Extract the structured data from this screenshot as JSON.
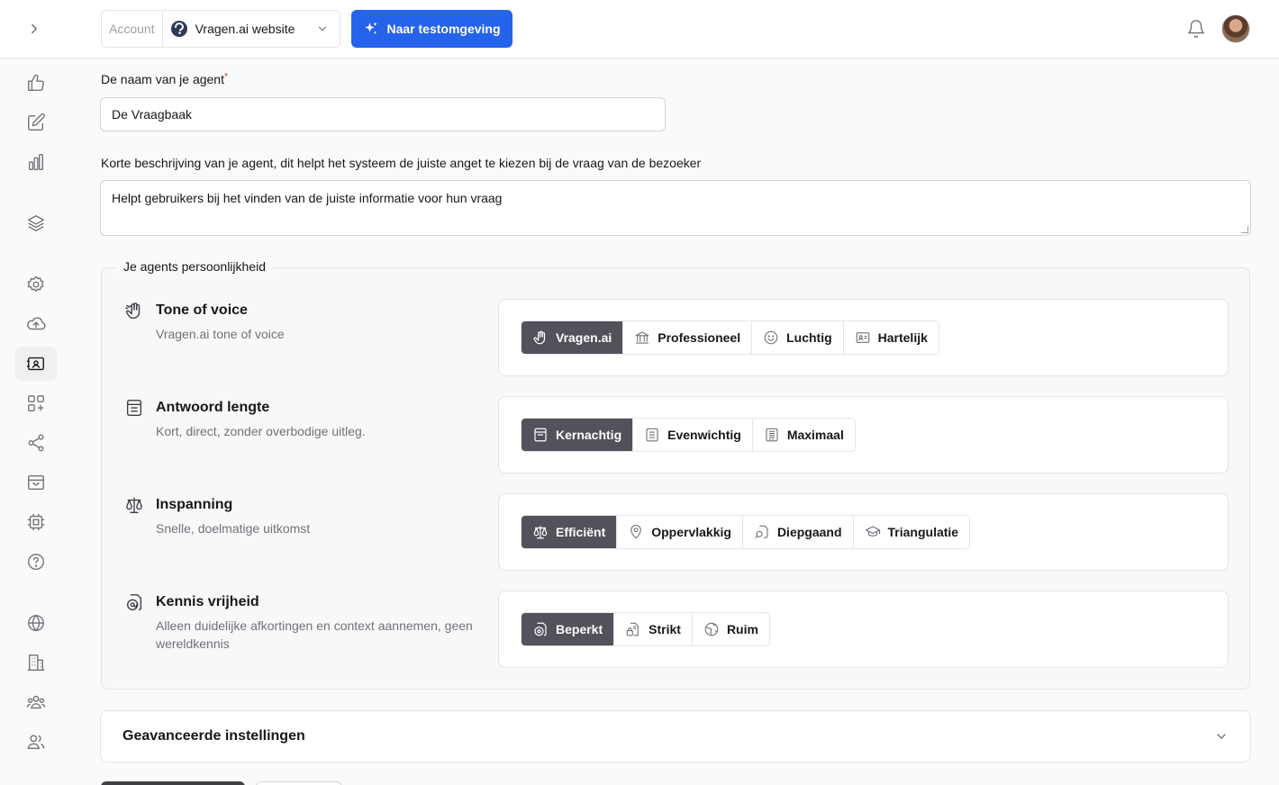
{
  "header": {
    "account_label": "Account",
    "account_name": "Vragen.ai website",
    "test_button_label": "Naar testomgeving"
  },
  "sidebar": {
    "items": [
      {
        "icon": "thumbs-up-icon"
      },
      {
        "icon": "edit-icon"
      },
      {
        "icon": "bar-chart-icon"
      },
      {
        "icon": "layers-icon"
      },
      {
        "icon": "gear-icon"
      },
      {
        "icon": "cloud-upload-icon"
      },
      {
        "icon": "agent-card-icon",
        "active": true
      },
      {
        "icon": "apps-add-icon"
      },
      {
        "icon": "share-icon"
      },
      {
        "icon": "inbox-icon"
      },
      {
        "icon": "chip-icon"
      },
      {
        "icon": "help-icon"
      },
      {
        "icon": "globe-icon"
      },
      {
        "icon": "building-icon"
      },
      {
        "icon": "team-icon"
      },
      {
        "icon": "users-icon"
      }
    ]
  },
  "form": {
    "name_label": "De naam van je agent",
    "name_required_mark": "*",
    "name_value": "De Vraagbaak",
    "description_label": "Korte beschrijving van je agent, dit helpt het systeem de juiste anget te kiezen bij de vraag van de bezoeker",
    "description_value": "Helpt gebruikers bij het vinden van de juiste informatie voor hun vraag"
  },
  "personality": {
    "legend": "Je agents persoonlijkheid",
    "tone": {
      "title": "Tone of voice",
      "description": "Vragen.ai tone of voice",
      "options": [
        "Vragen.ai",
        "Professioneel",
        "Luchtig",
        "Hartelijk"
      ],
      "selected": "Vragen.ai"
    },
    "length": {
      "title": "Antwoord lengte",
      "description": "Kort, direct, zonder overbodige uitleg.",
      "options": [
        "Kernachtig",
        "Evenwichtig",
        "Maximaal"
      ],
      "selected": "Kernachtig"
    },
    "effort": {
      "title": "Inspanning",
      "description": "Snelle, doelmatige uitkomst",
      "options": [
        "Efficiënt",
        "Oppervlakkig",
        "Diepgaand",
        "Triangulatie"
      ],
      "selected": "Efficiënt"
    },
    "knowledge": {
      "title": "Kennis vrijheid",
      "description": "Alleen duidelijke afkortingen en context aannemen, geen wereldkennis",
      "options": [
        "Beperkt",
        "Strikt",
        "Ruim"
      ],
      "selected": "Beperkt"
    }
  },
  "advanced": {
    "title": "Geavanceerde instellingen"
  }
}
